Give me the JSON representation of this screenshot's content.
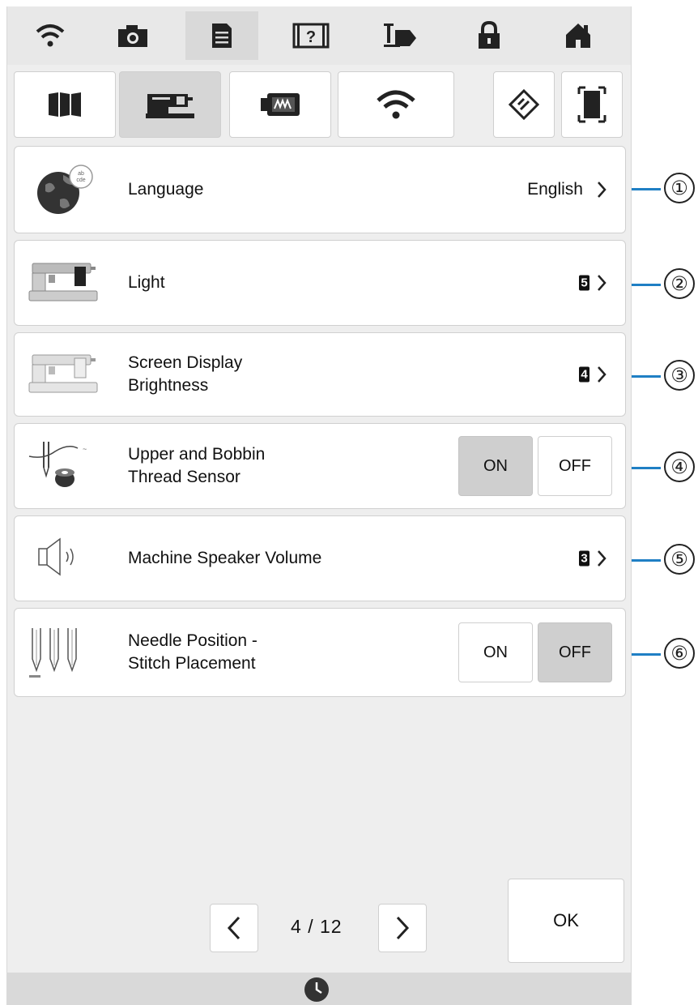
{
  "topbar": {
    "icons": [
      "wifi-icon",
      "camera-icon",
      "settings-page-icon",
      "help-icon",
      "presser-foot-icon",
      "lock-icon",
      "home-icon"
    ]
  },
  "tabs": {
    "icons": [
      "sewing-settings-icon",
      "machine-settings-icon",
      "embroidery-settings-icon",
      "wireless-settings-icon",
      "memory-icon",
      "screenshot-icon"
    ]
  },
  "settings": [
    {
      "label": "Language",
      "value": "English",
      "callout": "①"
    },
    {
      "label": "Light",
      "value": "5",
      "callout": "②"
    },
    {
      "label": "Screen Display\nBrightness",
      "value": "4",
      "callout": "③"
    },
    {
      "label": "Upper and Bobbin\nThread Sensor",
      "on_label": "ON",
      "off_label": "OFF",
      "state": "ON",
      "callout": "④"
    },
    {
      "label": "Machine Speaker Volume",
      "value": "3",
      "callout": "⑤"
    },
    {
      "label": "Needle Position -\nStitch Placement",
      "on_label": "ON",
      "off_label": "OFF",
      "state": "OFF",
      "callout": "⑥"
    }
  ],
  "pager": {
    "current": "4",
    "separator": "/",
    "total": "12"
  },
  "ok_label": "OK",
  "colors": {
    "callout_line": "#1f7fc4",
    "active_toggle": "#cfcfcf",
    "panel_bg": "#eeeeee"
  }
}
